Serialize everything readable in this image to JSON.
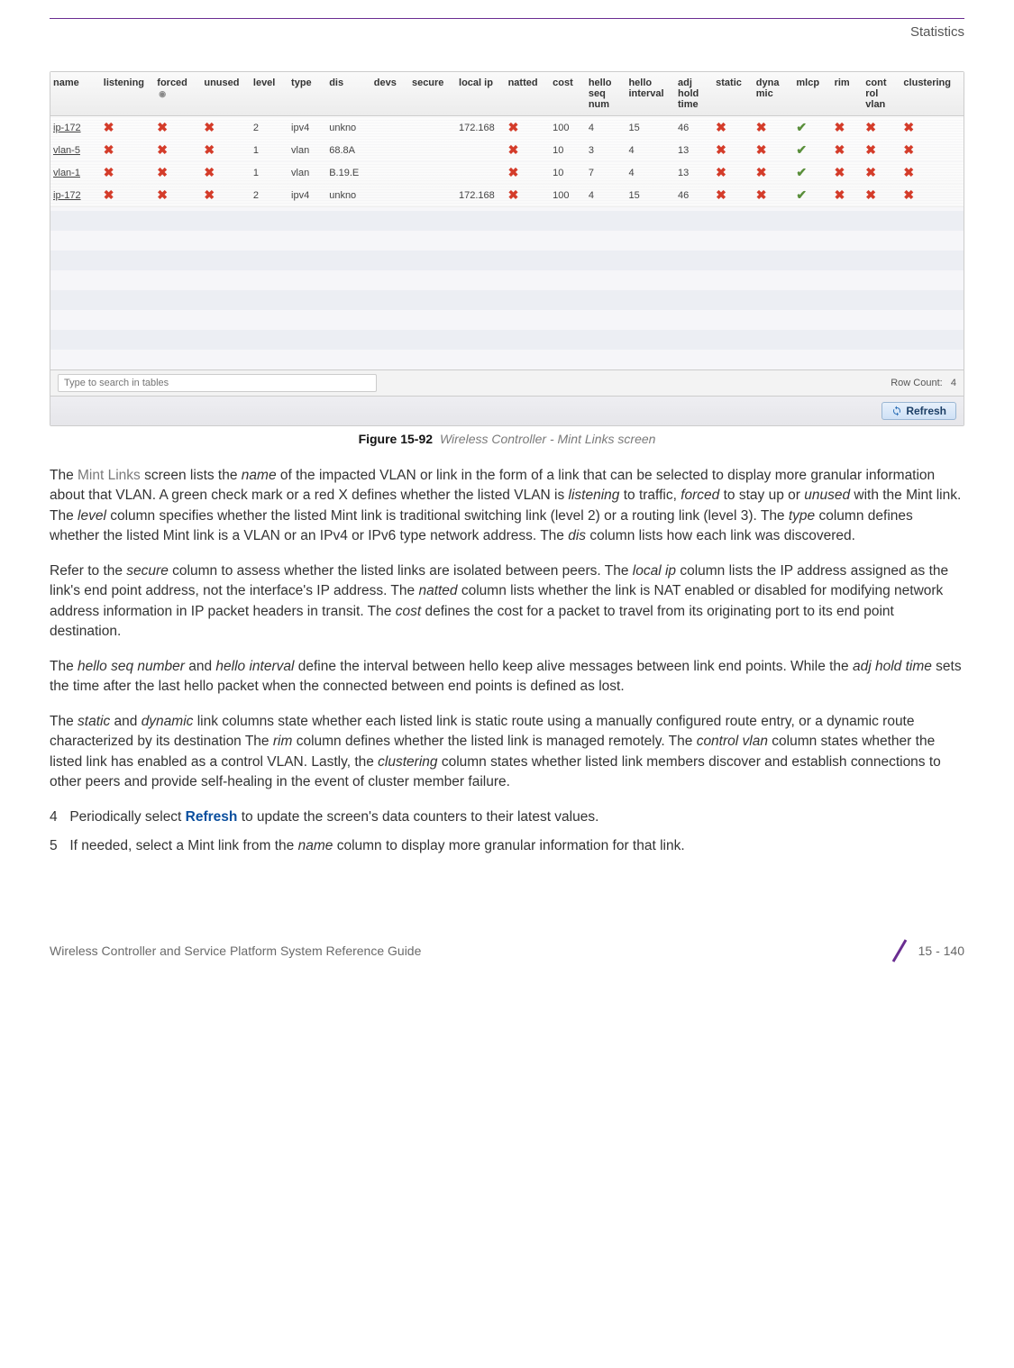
{
  "running_header": "Statistics",
  "screenshot": {
    "columns": [
      "name",
      "listening",
      "forced",
      "unused",
      "level",
      "type",
      "dis",
      "devs",
      "secure",
      "local ip",
      "natted",
      "cost",
      "hello seq num",
      "hello interval",
      "adj hold time",
      "static",
      "dyna mic",
      "mlcp",
      "rim",
      "cont rol vlan",
      "clustering"
    ],
    "sort_column_index": 2,
    "rows": [
      {
        "name": "ip-172",
        "listening": "x",
        "forced": "x",
        "unused": "x",
        "level": "2",
        "type": "ipv4",
        "dis": "unkno",
        "devs": "",
        "secure": "",
        "local_ip": "172.168",
        "natted": "x",
        "cost": "100",
        "hello_seq": "4",
        "hello_interval": "15",
        "adj_hold": "46",
        "static": "x",
        "dynamic": "x",
        "mlcp": "check",
        "rim": "x",
        "control_vlan": "x",
        "clustering": "x"
      },
      {
        "name": "vlan-5",
        "listening": "x",
        "forced": "x",
        "unused": "x",
        "level": "1",
        "type": "vlan",
        "dis": "68.8A",
        "devs": "",
        "secure": "",
        "local_ip": "",
        "natted": "x",
        "cost": "10",
        "hello_seq": "3",
        "hello_interval": "4",
        "adj_hold": "13",
        "static": "x",
        "dynamic": "x",
        "mlcp": "check",
        "rim": "x",
        "control_vlan": "x",
        "clustering": "x"
      },
      {
        "name": "vlan-1",
        "listening": "x",
        "forced": "x",
        "unused": "x",
        "level": "1",
        "type": "vlan",
        "dis": "B.19.E",
        "devs": "",
        "secure": "",
        "local_ip": "",
        "natted": "x",
        "cost": "10",
        "hello_seq": "7",
        "hello_interval": "4",
        "adj_hold": "13",
        "static": "x",
        "dynamic": "x",
        "mlcp": "check",
        "rim": "x",
        "control_vlan": "x",
        "clustering": "x"
      },
      {
        "name": "ip-172",
        "listening": "x",
        "forced": "x",
        "unused": "x",
        "level": "2",
        "type": "ipv4",
        "dis": "unkno",
        "devs": "",
        "secure": "",
        "local_ip": "172.168",
        "natted": "x",
        "cost": "100",
        "hello_seq": "4",
        "hello_interval": "15",
        "adj_hold": "46",
        "static": "x",
        "dynamic": "x",
        "mlcp": "check",
        "rim": "x",
        "control_vlan": "x",
        "clustering": "x"
      }
    ],
    "search_placeholder": "Type to search in tables",
    "row_count_label": "Row Count:",
    "row_count_value": "4",
    "refresh_button": "Refresh"
  },
  "figure": {
    "label": "Figure 15-92",
    "title": "Wireless Controller - Mint Links screen"
  },
  "paragraphs": {
    "p1_a": "The ",
    "p1_mint": "Mint Links",
    "p1_b": " screen lists the ",
    "p1_name": "name",
    "p1_c": " of the impacted VLAN or link in the form of a link that can be selected to display more granular information about that VLAN. A green check mark or a red X defines whether the listed VLAN is ",
    "p1_listening": "listening",
    "p1_d": " to traffic, ",
    "p1_forced": "forced",
    "p1_e": " to stay up or ",
    "p1_unused": "unused",
    "p1_f": " with the Mint link. The ",
    "p1_level": "level",
    "p1_g": " column specifies whether the listed Mint link is traditional switching link (level 2) or a routing link (level 3). The ",
    "p1_type": "type",
    "p1_h": " column defines whether the listed Mint link is a VLAN or an IPv4 or IPv6 type network address. The ",
    "p1_dis": "dis",
    "p1_i": " column lists how each link was discovered.",
    "p2_a": "Refer to the ",
    "p2_secure": "secure",
    "p2_b": " column to assess whether the listed links are isolated between peers. The ",
    "p2_localip": "local ip",
    "p2_c": " column lists the IP address assigned as the link's end point address, not the interface's IP address. The ",
    "p2_natted": "natted",
    "p2_d": " column lists whether the link is NAT enabled or disabled for modifying network address information in IP packet headers in transit. The ",
    "p2_cost": "cost",
    "p2_e": " defines the cost for a packet to travel from its originating port to its end point destination.",
    "p3_a": "The ",
    "p3_hseq": "hello seq number",
    "p3_b": " and ",
    "p3_hint": "hello interval",
    "p3_c": " define the interval between hello keep alive messages between link end points. While the ",
    "p3_adj": "adj hold time",
    "p3_d": " sets the time after the last hello packet when the connected between end points is defined as lost.",
    "p4_a": "The ",
    "p4_static": "static",
    "p4_b": " and ",
    "p4_dynamic": "dynamic",
    "p4_c": " link columns state whether each listed link is static route using a manually configured route entry, or a dynamic route characterized by its destination The ",
    "p4_rim": "rim",
    "p4_d": " column defines whether the listed link is managed remotely. The ",
    "p4_cvlan": "control vlan",
    "p4_e": " column states whether the listed link has enabled as a control VLAN. Lastly, the ",
    "p4_cluster": "clustering",
    "p4_f": " column states whether listed link members discover and establish connections to other peers and provide self-healing in the event of cluster member failure."
  },
  "steps": {
    "s4_num": "4",
    "s4_a": "Periodically select ",
    "s4_refresh": "Refresh",
    "s4_b": " to update the screen's data counters to their latest values.",
    "s5_num": "5",
    "s5_a": "If needed, select a Mint link from the ",
    "s5_name": "name",
    "s5_b": " column to display more granular information for that link."
  },
  "footer": {
    "left": "Wireless Controller and Service Platform System Reference Guide",
    "right": "15 - 140"
  }
}
